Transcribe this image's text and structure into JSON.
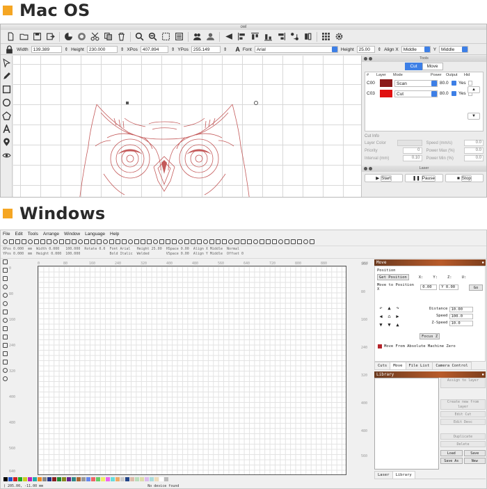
{
  "mac_heading": "Mac OS",
  "windows_heading": "Windows",
  "colors": {
    "accent": "#f5a623",
    "mac_blue": "#3d7fe6",
    "layer_c00": "#8b1a1a",
    "layer_c03": "#e01010",
    "owl_stroke": "#c45a5a"
  },
  "mac": {
    "window_title": "owl",
    "toolbar_icons": [
      "new-file-icon",
      "open-folder-icon",
      "save-icon",
      "export-icon",
      "pie-icon",
      "cut-circle-icon",
      "cut-icon",
      "copy-icon",
      "trash-icon",
      "zoom-in-icon",
      "zoom-out-icon",
      "frame-icon",
      "dotted-frame-icon",
      "group-icon",
      "ungroup-icon",
      "arrow-icon",
      "align-left-icon",
      "align-top-icon",
      "align-center-icon",
      "align-right-icon",
      "distribute-icon",
      "flip-icon",
      "grid-icon",
      "gear-icon"
    ],
    "props": {
      "width_label": "Width",
      "width_value": "139.389",
      "height_label": "Height",
      "height_value": "230.000",
      "xpos_label": "XPos",
      "xpos_value": "407.894",
      "ypos_label": "YPos",
      "ypos_value": "255.149",
      "font_label": "Font",
      "font_value": "Arial",
      "font_height_label": "Height",
      "font_height_value": "25.00",
      "alignx_label": "Align X",
      "alignx_value": "Middle",
      "aligny_label": "Y",
      "aligny_value": "Middle"
    },
    "panel": {
      "title": "Tools",
      "tab_cut": "Cut",
      "tab_move": "Move",
      "cols": {
        "num": "#",
        "layer": "Layer",
        "mode": "Mode",
        "power": "Power",
        "output": "Output",
        "hide": "Hid"
      },
      "layers": [
        {
          "name": "C00",
          "mode": "Scan",
          "power": "80.0",
          "output": "Yes"
        },
        {
          "name": "C03",
          "mode": "Cut",
          "power": "80.0",
          "output": "Yes"
        }
      ],
      "up_arrow": "▲",
      "down_arrow": "▼",
      "cut_info": "Cut Info",
      "layer_color": "Layer Color",
      "priority_label": "Priority",
      "priority_value": "0",
      "interval_label": "Interval (mm)",
      "interval_value": "0.10",
      "speed_label": "Speed (mm/s)",
      "speed_value": "0.0",
      "power_max_label": "Power Max (%)",
      "power_max_value": "0.0",
      "power_min_label": "Power Min (%)",
      "power_min_value": "0.0",
      "laser_title": "Laser",
      "start": "Start",
      "pause": "Pause",
      "stop": "Stop"
    }
  },
  "win": {
    "menu": [
      "File",
      "Edit",
      "Tools",
      "Arrange",
      "Window",
      "Language",
      "Help"
    ],
    "props": {
      "xpos": "XPos 0.000",
      "ypos": "YPos 0.000",
      "width": "Width 0.000",
      "height": "Height 0.000",
      "mm1": "mm",
      "mm2": "mm",
      "pct1": "100.000",
      "pct2": "100.000",
      "rotate": "Rotate 0.0",
      "font": "Font Arial",
      "bold": "Bold",
      "italic": "Italic",
      "fheight": "Height 25.00",
      "welded": "Welded",
      "hspace": "HSpace 0.00",
      "vspace": "VSpace 0.00",
      "alignx": "Align X Middle",
      "aligny": "Align Y Middle",
      "normal": "Normal",
      "offset": "Offset 0"
    },
    "ruler_top": [
      "0",
      "80",
      "160",
      "240",
      "320",
      "400",
      "480",
      "560",
      "640",
      "720",
      "800",
      "880",
      "960"
    ],
    "ruler_left": [
      "0",
      "80",
      "160",
      "240",
      "320",
      "400",
      "480",
      "560",
      "640"
    ],
    "ruler_right": [
      "80",
      "160",
      "240",
      "320",
      "400",
      "480",
      "560",
      "640",
      "960"
    ],
    "move": {
      "title": "Move",
      "position_header": "Position",
      "get_position": "Get Position",
      "x": "X:",
      "y": "Y:",
      "z": "Z:",
      "u": "U:",
      "move_to": "Move to Position X",
      "mx": "0.00",
      "my": "Y 0.00",
      "go": "Go",
      "distance_label": "Distance",
      "distance_value": "10.00",
      "speed_label": "Speed",
      "speed_value": "100.0",
      "zspeed_label": "Z-Speed",
      "zspeed_value": "10.0",
      "focus": "Focus Z",
      "absolute": "Move From Absolute Machine Zero",
      "arrows": [
        "↶",
        "▲",
        "↷",
        "◀",
        "⌂",
        "▶",
        "▼",
        "▼",
        "▲"
      ]
    },
    "tabs": [
      "Cuts",
      "Move",
      "File List",
      "Camera Control"
    ],
    "library": {
      "title": "Library",
      "assign": "Assign to layer",
      "create": "Create new from layer",
      "edit_cut": "Edit Cut",
      "edit_desc": "Edit Desc",
      "duplicate": "Duplicate",
      "delete": "Delete",
      "load": "Load",
      "save": "Save",
      "save_as": "Save As",
      "new": "New"
    },
    "bottom_tabs": [
      "Laser",
      "Library"
    ],
    "status_left": "( 205.00, -11.00 mm",
    "status_right": "No device found",
    "palette": [
      "#000000",
      "#2255cc",
      "#cc2222",
      "#22aa22",
      "#cccc22",
      "#bb22bb",
      "#22aaaa",
      "#ee8822",
      "#888888",
      "#223388",
      "#882222",
      "#228833",
      "#888822",
      "#662288",
      "#338888",
      "#aa6633",
      "#999999",
      "#6688ee",
      "#ee6666",
      "#66cc66",
      "#eeee66",
      "#ee66ee",
      "#66dddd",
      "#eeaa66",
      "#cccccc",
      "#224488",
      "#ddbbaa",
      "#bbddbb",
      "#ddddaa",
      "#ddbbee",
      "#aadddd",
      "#eeddbb",
      "#ffffff",
      "#bbbbbb"
    ]
  }
}
